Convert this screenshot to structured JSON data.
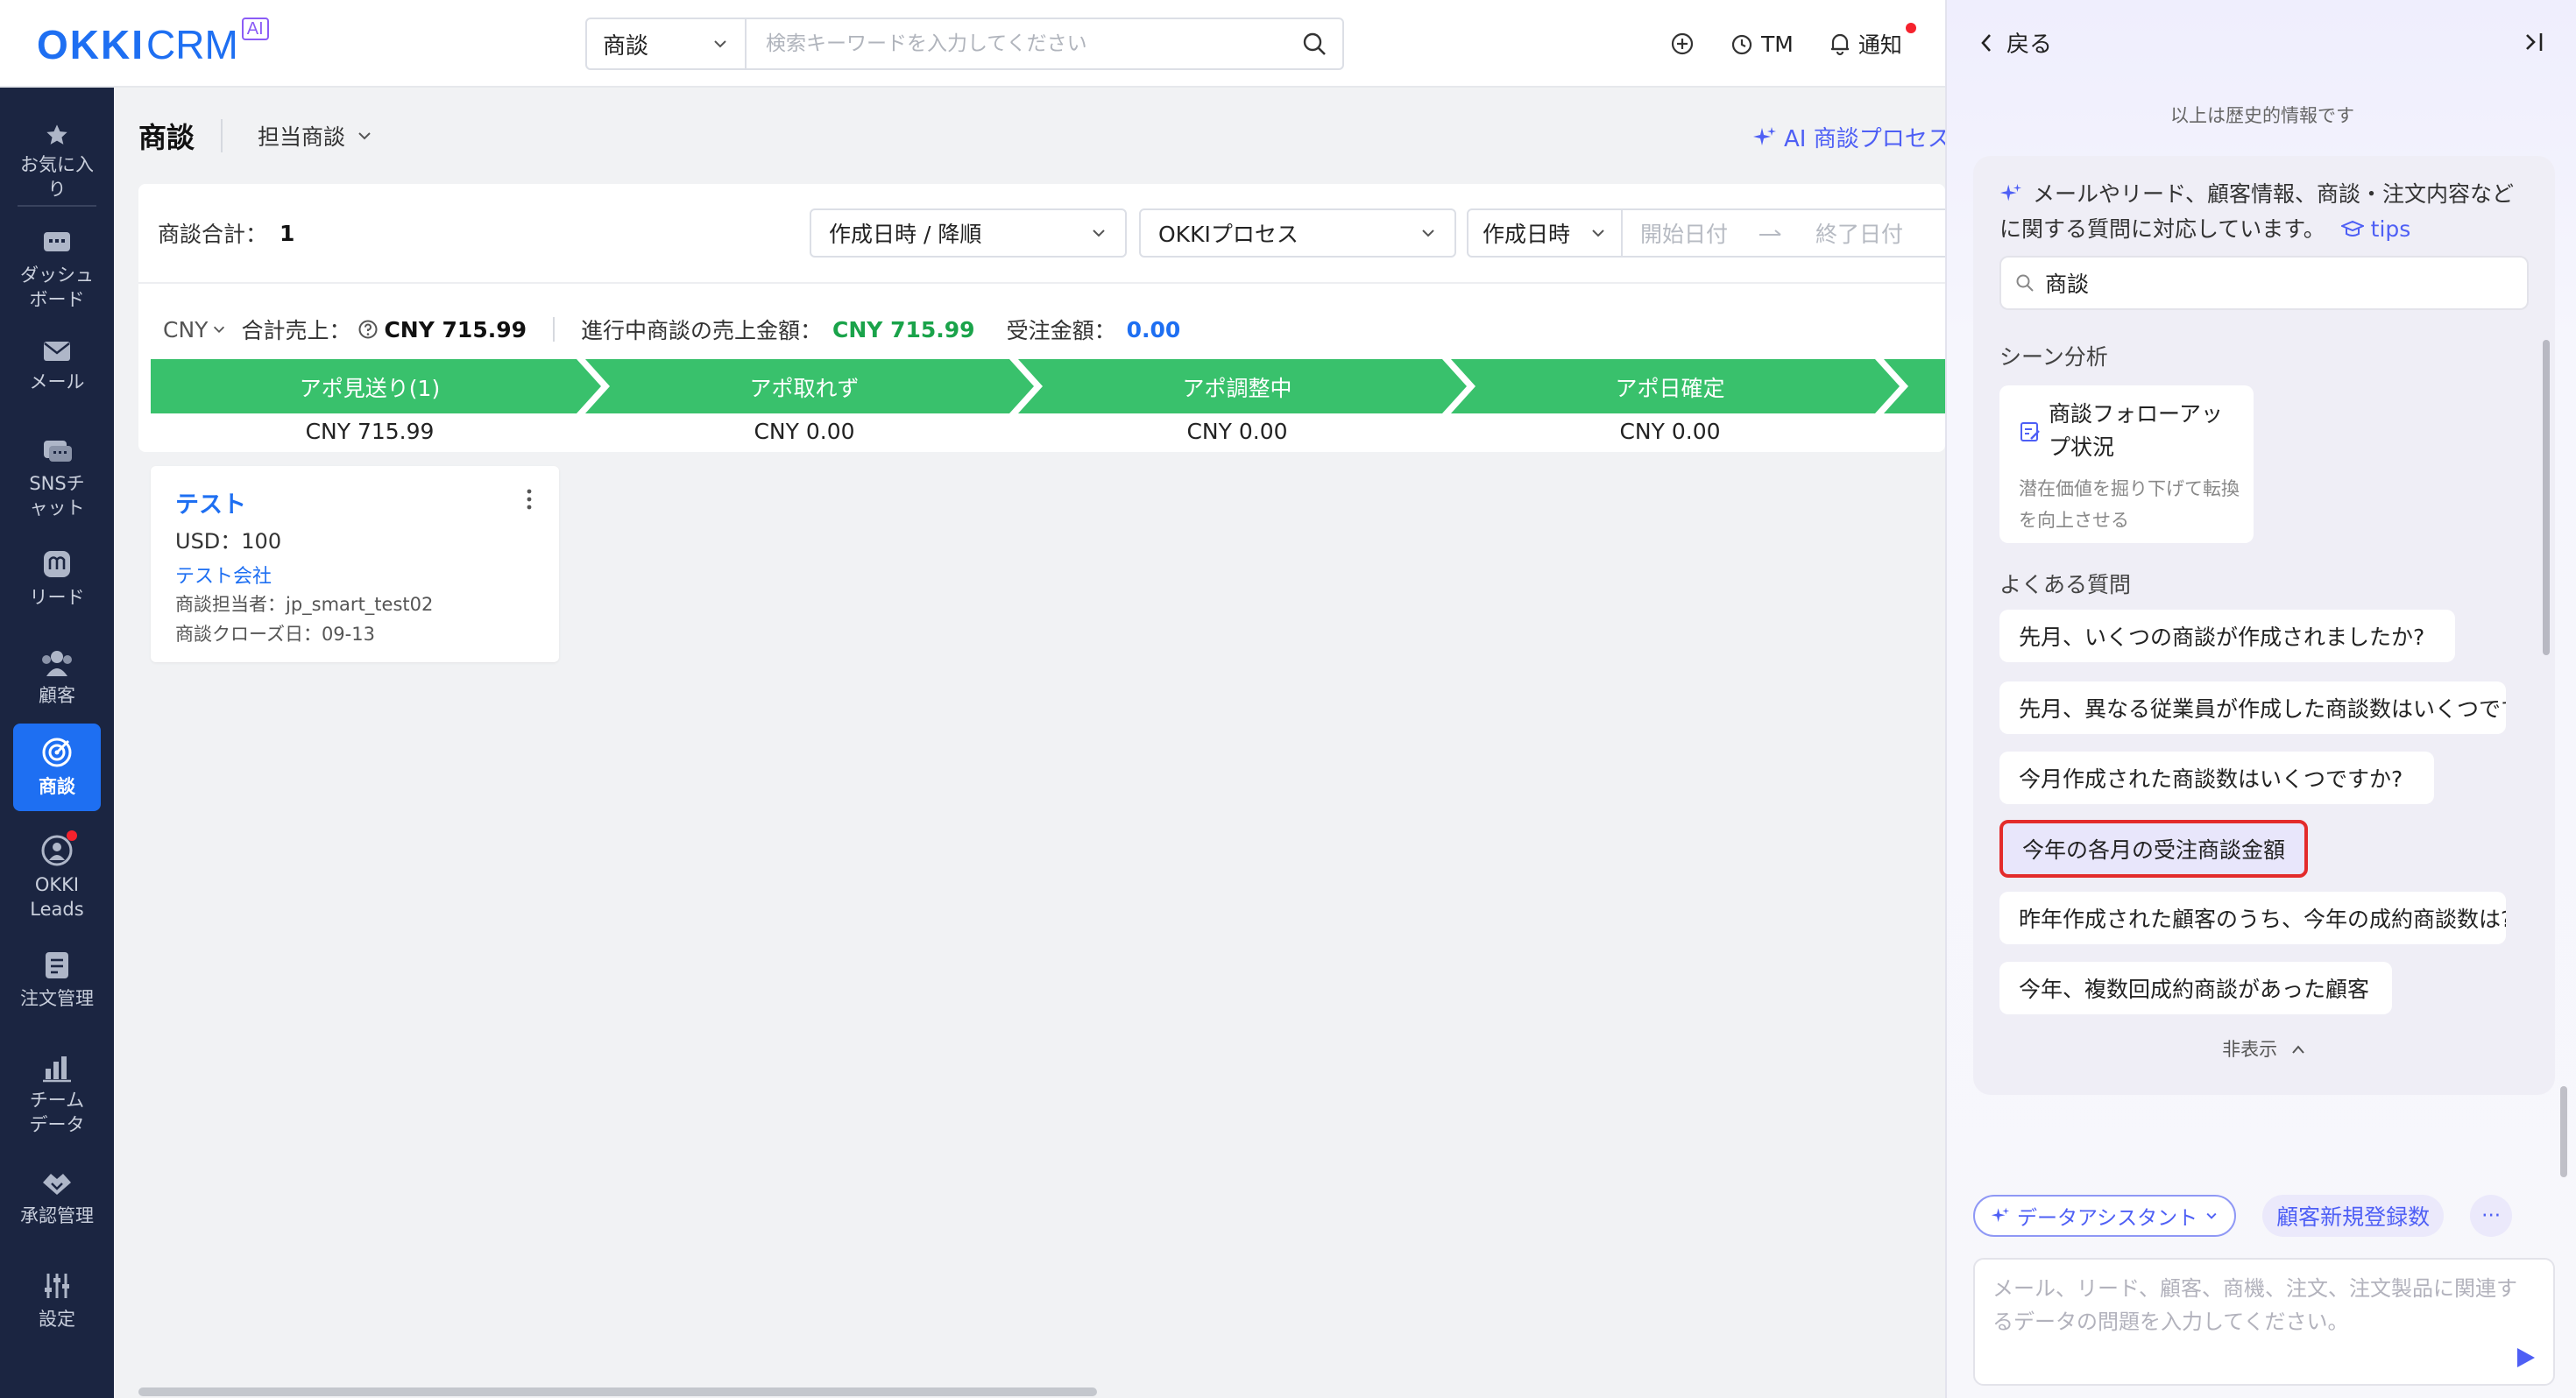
{
  "logo": {
    "okki": "OKKI",
    "crm": "CRM",
    "ai_badge": "AI"
  },
  "search": {
    "scope": "商談",
    "placeholder": "検索キーワードを入力してください"
  },
  "top_actions": {
    "user": "TM",
    "notify": "通知"
  },
  "sidebar": {
    "items": [
      {
        "label": "お気に入り",
        "icon": "star-icon"
      },
      {
        "label": "ダッシュボード",
        "icon": "dashboard-icon"
      },
      {
        "label": "メール",
        "icon": "mail-icon"
      },
      {
        "label": "SNSチャット",
        "icon": "chat-icon"
      },
      {
        "label": "リード",
        "icon": "lead-icon"
      },
      {
        "label": "顧客",
        "icon": "customers-icon"
      },
      {
        "label": "商談",
        "icon": "target-icon"
      },
      {
        "label": "OKKI Leads",
        "icon": "okki-leads-icon"
      },
      {
        "label": "注文管理",
        "icon": "order-icon"
      },
      {
        "label": "チームデータ",
        "icon": "team-data-icon"
      },
      {
        "label": "承認管理",
        "icon": "approval-icon"
      },
      {
        "label": "設定",
        "icon": "settings-icon"
      }
    ]
  },
  "header": {
    "title": "商談",
    "view": "担当商談",
    "ai_process": "AI 商談プロセス"
  },
  "filters": {
    "total_label": "商談合計：",
    "total_value": "1",
    "sort": "作成日時 / 降順",
    "process": "OKKIプロセス",
    "date_field": "作成日時",
    "start_placeholder": "開始日付",
    "end_placeholder": "終了日付"
  },
  "summary": {
    "currency": "CNY",
    "sales_label": "合計売上：",
    "sales_value": "CNY 715.99",
    "ongoing_label": "進行中商談の売上金額：",
    "ongoing_value": "CNY 715.99",
    "won_label": "受注金額：",
    "won_value": "0.00"
  },
  "stages": [
    {
      "name": "アポ見送り(1)",
      "amount": "CNY 715.99"
    },
    {
      "name": "アポ取れず",
      "amount": "CNY 0.00"
    },
    {
      "name": "アポ調整中",
      "amount": "CNY 0.00"
    },
    {
      "name": "アポ日確定",
      "amount": "CNY 0.00"
    }
  ],
  "deal_card": {
    "title": "テスト",
    "amount": "USD：100",
    "company": "テスト会社",
    "owner": "商談担当者：jp_smart_test02",
    "close_date": "商談クローズ日：09-13"
  },
  "ai_panel": {
    "back": "戻る",
    "history_note": "以上は歴史的情報です",
    "intro": "メールやリード、顧客情報、商談・注文内容などに関する質問に対応しています。",
    "tips": "tips",
    "search_value": "商談",
    "scene_title": "シーン分析",
    "scene_card": {
      "title": "商談フォローアップ状況",
      "desc": "潜在価値を掘り下げて転換を向上させる"
    },
    "faq_title": "よくある質問",
    "faqs": [
      "先月、いくつの商談が作成されましたか?",
      "先月、異なる従業員が作成した商談数はいくつですか?",
      "今月作成された商談数はいくつですか?",
      "今年の各月の受注商談金額",
      "昨年作成された顧客のうち、今年の成約商談数は?",
      "今年、複数回成約商談があった顧客"
    ],
    "hide": "非表示",
    "assistant_chip": "データアシスタント",
    "suggest_chip": "顧客新規登録数",
    "more_chip": "···",
    "input_placeholder": "メール、リード、顧客、商機、注文、注文製品に関連するデータの問題を入力してください。"
  },
  "colors": {
    "brand": "#1e6ff2",
    "stage_green": "#39c16c",
    "ai_purple": "#4e5ff5",
    "sidebar_bg": "#1b2541",
    "highlight_border": "#e32b2b"
  }
}
